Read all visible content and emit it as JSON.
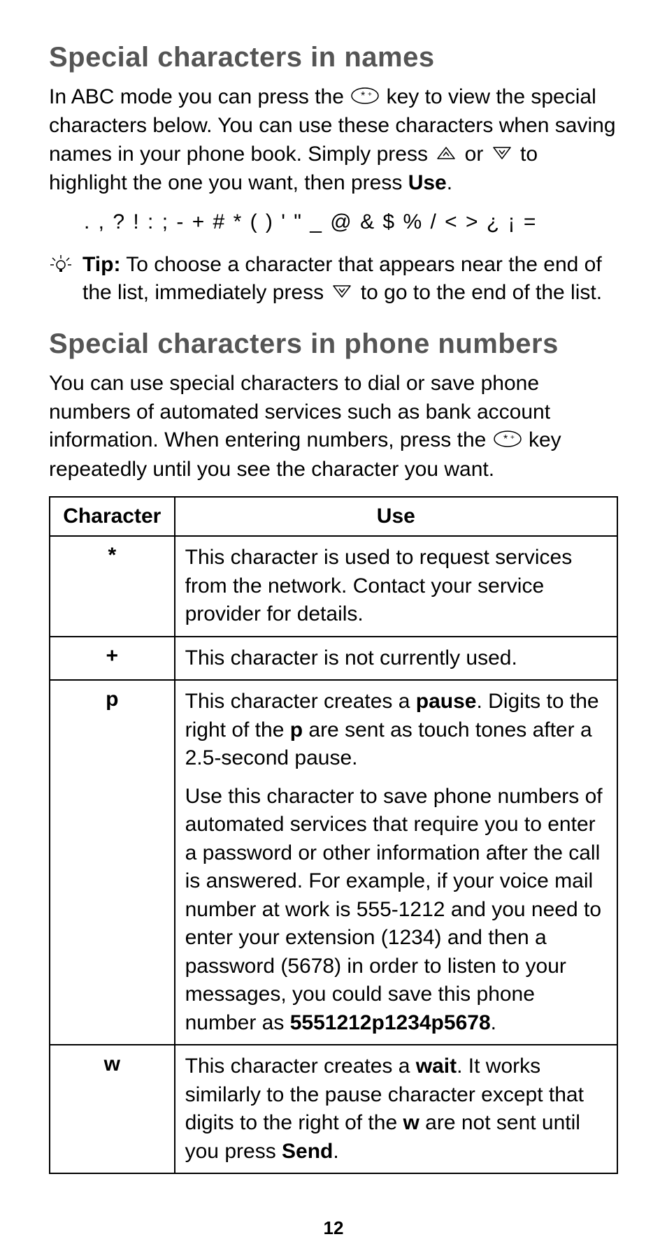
{
  "section1": {
    "title": "Special characters in names",
    "para_pre": "In ABC mode you can press the ",
    "para_mid1": " key to view the special characters below. You can use these characters when saving names in your phone book. Simply press ",
    "para_mid2": " or ",
    "para_mid3": " to highlight the one you want, then press ",
    "para_bold": "Use",
    "para_end": ".",
    "chars": ". , ? ! : ; - + # * ( ) ' \" _ @ & $ % / < > ¿ ¡ =",
    "tip_label": "Tip:",
    "tip_pre": "  To choose a character that appears near the end of the list, immediately press ",
    "tip_post": " to go to the end of the list."
  },
  "section2": {
    "title": "Special characters in phone numbers",
    "para_pre": "You can use special characters to dial or save phone numbers of automated services such as bank account information. When entering numbers, press the ",
    "para_post": " key repeatedly until you see the character you want."
  },
  "table": {
    "head_char": "Character",
    "head_use": "Use",
    "rows": [
      {
        "char": "*",
        "use1": "This character is used to request services from the network. Contact your service provider for details."
      },
      {
        "char": "+",
        "use1": "This character is not currently used."
      },
      {
        "char": "p",
        "use1_pre": "This character creates a ",
        "use1_b1": "pause",
        "use1_mid": ". Digits to the right of the ",
        "use1_b2": "p",
        "use1_post": " are sent as touch tones after a 2.5-second pause.",
        "use2_pre": "Use this character to save phone numbers of automated services that require you to enter a password or other information after the call is answered. For example, if your voice mail number at work is 555-1212 and you need to enter your extension (1234) and then a password (5678) in order to listen to your messages, you could save this phone number as ",
        "use2_b": "5551212p1234p5678",
        "use2_post": "."
      },
      {
        "char": "w",
        "use1_pre": "This character creates a ",
        "use1_b1": "wait",
        "use1_mid": ". It works similarly to the pause character except that digits to the right of the ",
        "use1_b2": "w",
        "use1_mid2": " are not sent until you press ",
        "use1_b3": "Send",
        "use1_post": "."
      }
    ]
  },
  "page_number": "12"
}
